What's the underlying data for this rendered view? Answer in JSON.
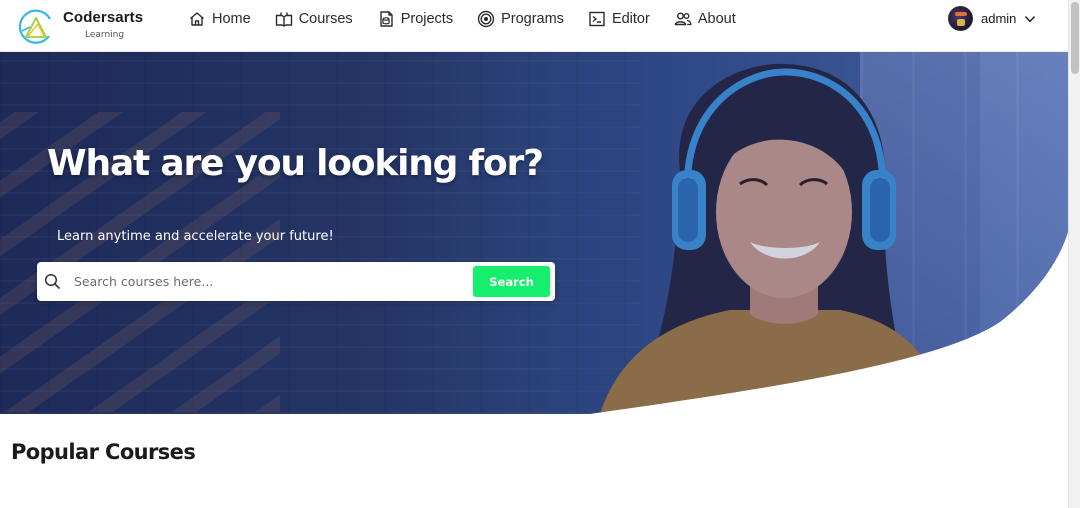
{
  "brand": {
    "name": "Codersarts",
    "subtitle": "Learning"
  },
  "nav": {
    "items": [
      {
        "label": "Home",
        "icon": "home-icon"
      },
      {
        "label": "Courses",
        "icon": "book-icon"
      },
      {
        "label": "Projects",
        "icon": "file-stack-icon"
      },
      {
        "label": "Programs",
        "icon": "target-icon"
      },
      {
        "label": "Editor",
        "icon": "terminal-icon"
      },
      {
        "label": "About",
        "icon": "users-icon"
      }
    ]
  },
  "user": {
    "name": "admin",
    "icon": "chevron-down-icon"
  },
  "hero": {
    "title": "What are you looking for?",
    "subtitle": "Learn anytime and accelerate your future!"
  },
  "search": {
    "placeholder": "Search courses here...",
    "button_label": "Search",
    "icon": "search-icon"
  },
  "sections": {
    "popular_title": "Popular Courses"
  },
  "colors": {
    "accent_green": "#16ee6e",
    "hero_navy": "#243566"
  }
}
